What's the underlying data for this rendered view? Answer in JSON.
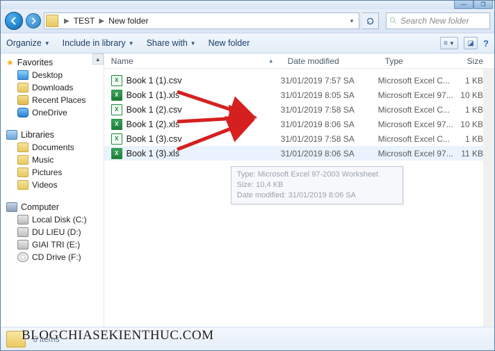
{
  "breadcrumb": {
    "root": "TEST",
    "current": "New folder"
  },
  "search": {
    "placeholder": "Search New folder"
  },
  "toolbar": {
    "organize": "Organize",
    "include": "Include in library",
    "share": "Share with",
    "newfolder": "New folder"
  },
  "columns": {
    "name": "Name",
    "date": "Date modified",
    "type": "Type",
    "size": "Size"
  },
  "nav": {
    "favorites": "Favorites",
    "desktop": "Desktop",
    "downloads": "Downloads",
    "recent": "Recent Places",
    "onedrive": "OneDrive",
    "libraries": "Libraries",
    "documents": "Documents",
    "music": "Music",
    "pictures": "Pictures",
    "videos": "Videos",
    "computer": "Computer",
    "localdisk": "Local Disk (C:)",
    "dulieu": "DU LIEU (D:)",
    "giaitri": "GIAI TRI (E:)",
    "cddrive": "CD Drive (F:)"
  },
  "files": [
    {
      "name": "Book 1 (1).csv",
      "date": "31/01/2019 7:57 SA",
      "type": "Microsoft Excel C...",
      "size": "1 KB",
      "ext": "csv"
    },
    {
      "name": "Book 1 (1).xls",
      "date": "31/01/2019 8:05 SA",
      "type": "Microsoft Excel 97...",
      "size": "10 KB",
      "ext": "xls"
    },
    {
      "name": "Book 1 (2).csv",
      "date": "31/01/2019 7:58 SA",
      "type": "Microsoft Excel C...",
      "size": "1 KB",
      "ext": "csv"
    },
    {
      "name": "Book 1 (2).xls",
      "date": "31/01/2019 8:06 SA",
      "type": "Microsoft Excel 97...",
      "size": "10 KB",
      "ext": "xls"
    },
    {
      "name": "Book 1 (3).csv",
      "date": "31/01/2019 7:58 SA",
      "type": "Microsoft Excel C...",
      "size": "1 KB",
      "ext": "csv"
    },
    {
      "name": "Book 1 (3).xls",
      "date": "31/01/2019 8:06 SA",
      "type": "Microsoft Excel 97...",
      "size": "11 KB",
      "ext": "xls"
    }
  ],
  "tooltip": {
    "line1": "Type: Microsoft Excel 97-2003 Worksheet",
    "line2": "Size: 10,4 KB",
    "line3": "Date modified: 31/01/2019 8:06 SA"
  },
  "status": {
    "count": "6 items"
  },
  "watermark": "BLOGCHIASEKIENTHUC.COM"
}
